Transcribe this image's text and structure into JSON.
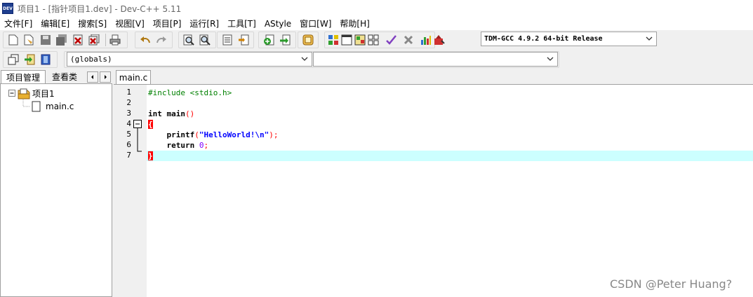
{
  "window": {
    "title": "项目1 - [指针项目1.dev] - Dev-C++ 5.11",
    "icon_text": "DEV"
  },
  "menu": {
    "items": [
      {
        "label": "文件[F]"
      },
      {
        "label": "编辑[E]"
      },
      {
        "label": "搜索[S]"
      },
      {
        "label": "视图[V]"
      },
      {
        "label": "项目[P]"
      },
      {
        "label": "运行[R]"
      },
      {
        "label": "工具[T]"
      },
      {
        "label": "AStyle"
      },
      {
        "label": "窗口[W]"
      },
      {
        "label": "帮助[H]"
      }
    ]
  },
  "toolbar": {
    "compiler_select": "TDM-GCC 4.9.2 64-bit Release",
    "scope_select": "(globals)",
    "function_select": ""
  },
  "left_panel": {
    "tabs": [
      "项目管理",
      "查看类"
    ],
    "tree": {
      "project": "项目1",
      "files": [
        "main.c"
      ]
    }
  },
  "editor": {
    "tab": "main.c",
    "line_numbers": [
      "1",
      "2",
      "3",
      "4",
      "5",
      "6",
      "7"
    ],
    "lines": [
      {
        "parts": [
          {
            "t": "#include <stdio.h>",
            "c": "pp"
          }
        ]
      },
      {
        "parts": []
      },
      {
        "parts": [
          {
            "t": "int",
            "c": "kw"
          },
          {
            "t": " ",
            "c": ""
          },
          {
            "t": "main",
            "c": "kw"
          },
          {
            "t": "()",
            "c": "sym"
          }
        ]
      },
      {
        "parts": [
          {
            "t": "{",
            "c": "brace-hl"
          }
        ]
      },
      {
        "parts": [
          {
            "t": "    printf",
            "c": "kw"
          },
          {
            "t": "(",
            "c": "sym"
          },
          {
            "t": "\"HelloWorld!\\n\"",
            "c": "str"
          },
          {
            "t": ");",
            "c": "sym"
          }
        ]
      },
      {
        "parts": [
          {
            "t": "    ",
            "c": ""
          },
          {
            "t": "return",
            "c": "kw"
          },
          {
            "t": " ",
            "c": ""
          },
          {
            "t": "0",
            "c": "num"
          },
          {
            "t": ";",
            "c": "sym"
          }
        ]
      },
      {
        "parts": [
          {
            "t": "}",
            "c": "brace-hl"
          }
        ]
      }
    ],
    "fold_markers": [
      "⊟"
    ]
  },
  "watermark": "CSDN @Peter  Huang?",
  "colors": {
    "current_line": "#ccffff",
    "brace_highlight": "#ff0000",
    "string": "#0000ff",
    "preprocessor": "#008000",
    "number": "#8000ff"
  },
  "icons": [
    "new-file-icon",
    "open-file-icon",
    "save-icon",
    "save-all-icon",
    "close-file-icon",
    "close-all-icon",
    "print-icon",
    "undo-icon",
    "redo-icon",
    "find-icon",
    "replace-icon",
    "goto-icon",
    "bookmark-icon",
    "new-project-icon",
    "add-file-icon",
    "remove-file-icon",
    "project-options-icon",
    "compile-icon",
    "run-icon",
    "compile-run-icon",
    "rebuild-icon",
    "syntax-check-icon",
    "stop-icon",
    "profile-icon",
    "debug-icon"
  ]
}
